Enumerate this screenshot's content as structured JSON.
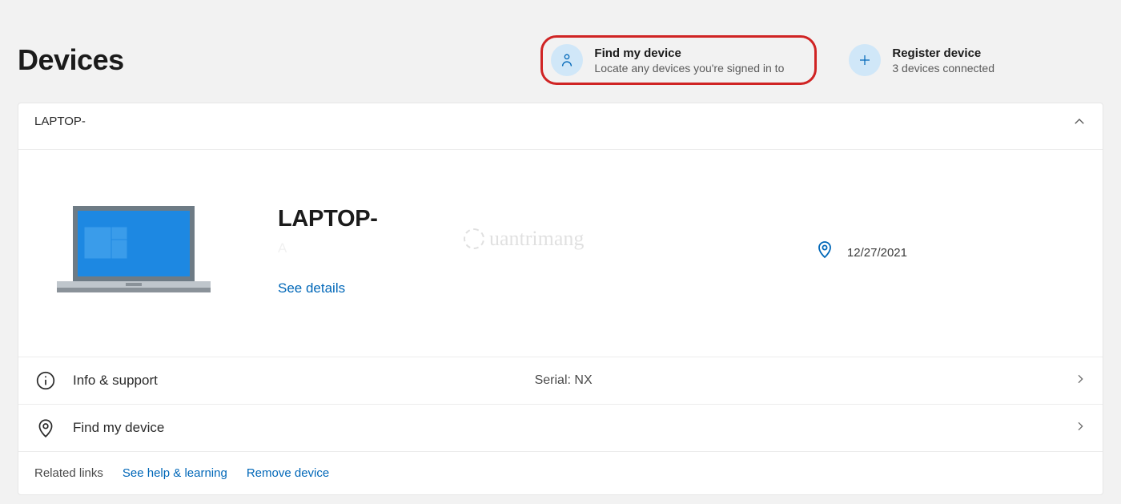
{
  "header": {
    "title": "Devices",
    "actions": {
      "findDevice": {
        "title": "Find my device",
        "subtitle": "Locate any devices you're signed in to"
      },
      "registerDevice": {
        "title": "Register device",
        "subtitle": "3 devices connected"
      }
    }
  },
  "device": {
    "headerName": "LAPTOP-",
    "name": "LAPTOP-",
    "subline": "A",
    "seeDetails": "See details",
    "location": {
      "line1": " ",
      "date": "12/27/2021"
    }
  },
  "rows": {
    "info": {
      "label": "Info & support",
      "serialPrefix": "Serial: NX"
    },
    "find": {
      "label": "Find my device"
    }
  },
  "footer": {
    "relatedLinks": "Related links",
    "help": "See help & learning",
    "remove": "Remove device"
  },
  "watermark": "uantrimang"
}
